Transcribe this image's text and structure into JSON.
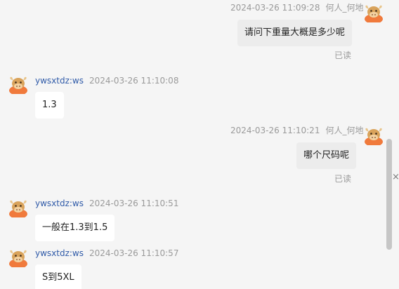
{
  "messages": [
    {
      "direction": "out",
      "time": "2024-03-26 11:09:28",
      "sender": "何人_何地",
      "text": "请问下重量大概是多少呢",
      "status": "已读"
    },
    {
      "direction": "in",
      "sender": "ywsxtdz:ws",
      "time": "2024-03-26 11:10:08",
      "text": "1.3"
    },
    {
      "direction": "out",
      "time": "2024-03-26 11:10:21",
      "sender": "何人_何地",
      "text": "哪个尺码呢",
      "status": "已读"
    },
    {
      "direction": "in",
      "sender": "ywsxtdz:ws",
      "time": "2024-03-26 11:10:51",
      "text": "一般在1.3到1.5"
    },
    {
      "direction": "in",
      "sender": "ywsxtdz:ws",
      "time": "2024-03-26 11:10:57",
      "text": "S到5XL"
    }
  ],
  "icons": {
    "avatar": "cartoon-bull-avatar-icon",
    "close": "close-icon"
  },
  "side_close_label": "×",
  "colors": {
    "background": "#f5f5f5",
    "incoming_bubble": "#ffffff",
    "outgoing_bubble": "#ececec",
    "sender_name": "#2f5aa8",
    "meta_text": "#9a9a9a",
    "avatar_orange": "#f07a3c"
  }
}
